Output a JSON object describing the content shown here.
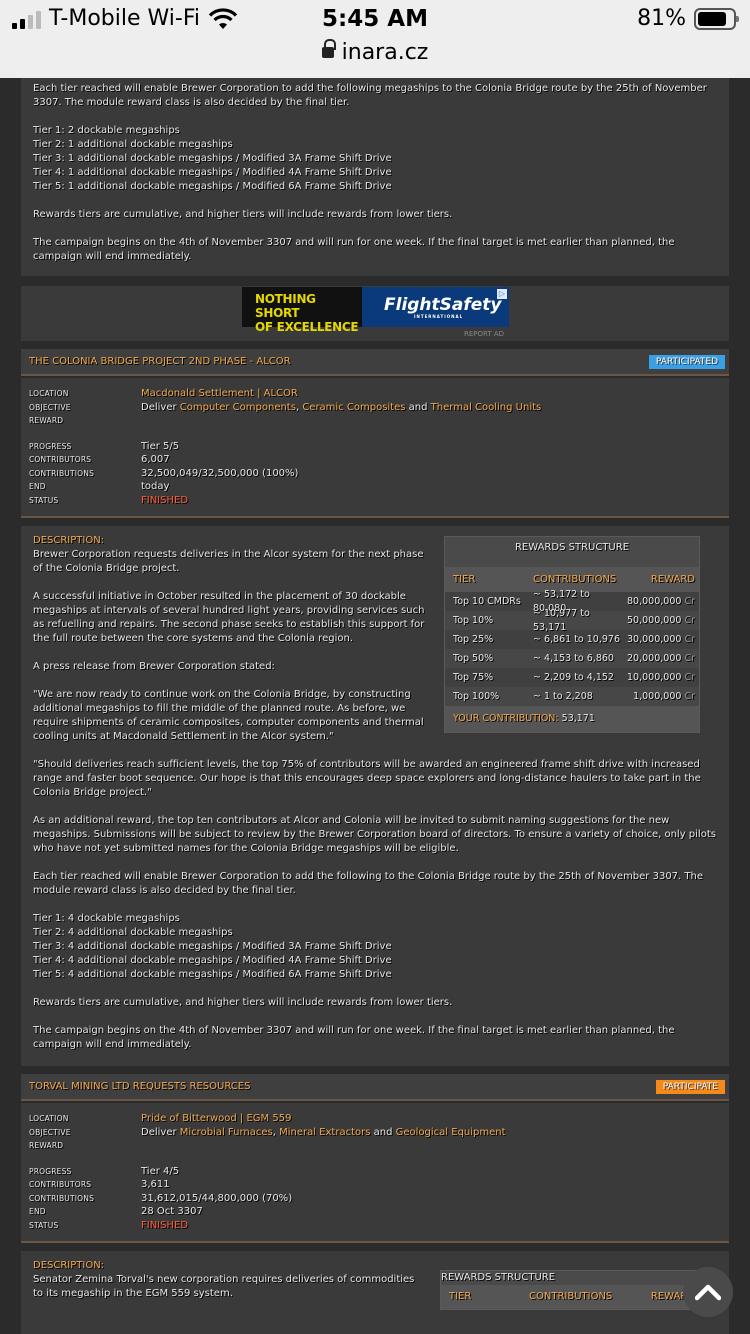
{
  "status_bar": {
    "carrier": "T-Mobile Wi-Fi",
    "time": "5:45 AM",
    "battery": "81%",
    "url": "inara.cz"
  },
  "top_section": {
    "paragraphs": [
      "Each tier reached will enable Brewer Corporation to add the following megaships to the Colonia Bridge route by the 25th of November 3307. The module reward class is also decided by the final tier.",
      "Tier 1: 2 dockable megaships\nTier 2: 1 additional dockable megaships\nTier 3: 1 additional dockable megaships / Modified 3A Frame Shift Drive\nTier 4: 1 additional dockable megaships / Modified 4A Frame Shift Drive\nTier 5: 1 additional dockable megaships / Modified 6A Frame Shift Drive",
      "Rewards tiers are cumulative, and higher tiers will include rewards from lower tiers.",
      "The campaign begins on the 4th of November 3307 and will run for one week. If the final target is met earlier than planned, the campaign will end immediately."
    ]
  },
  "ad": {
    "line1": "NOTHING SHORT",
    "line2": "OF EXCELLENCE",
    "brand": "FlightSafety",
    "brand_sub": "INTERNATIONAL",
    "report": "REPORT AD"
  },
  "labels": {
    "location": "LOCATION",
    "objective": "OBJECTIVE",
    "reward": "REWARD",
    "progress": "PROGRESS",
    "contributors": "CONTRIBUTORS",
    "contributions": "CONTRIBUTIONS",
    "end": "END",
    "status": "STATUS",
    "description": "DESCRIPTION:",
    "rewards_structure": "REWARDS STRUCTURE",
    "tier": "TIER",
    "contrib_col": "CONTRIBUTIONS",
    "reward_col": "REWARD",
    "your_contribution": "YOUR CONTRIBUTION:",
    "deliver": "Deliver",
    "and": "and",
    "cr": "Cr"
  },
  "cg1": {
    "title": "THE COLONIA BRIDGE PROJECT 2ND PHASE - ALCOR",
    "badge": "PARTICIPATED",
    "location": "Macdonald Settlement | ALCOR",
    "commodities": [
      "Computer Components",
      "Ceramic Composites",
      "Thermal Cooling Units"
    ],
    "progress": "Tier 5/5",
    "contributors": "6,007",
    "contributions": "32,500,049/32,500,000 (100%)",
    "end": "today",
    "status": "FINISHED",
    "description_intro": [
      "Brewer Corporation requests deliveries in the Alcor system for the next phase of the Colonia Bridge project.",
      "A successful initiative in October resulted in the placement of 30 dockable megaships at intervals of several hundred light years, providing services such as refuelling and repairs. The second phase seeks to establish this support for the full route between the core systems and the Colonia region.",
      "A press release from Brewer Corporation stated:",
      "\"We are now ready to continue work on the Colonia Bridge, by constructing additional megaships to fill the middle of the planned route. As before, we require shipments of ceramic composites, computer components and thermal cooling units at Macdonald Settlement in the Alcor system.\""
    ],
    "description_rest": [
      "\"Should deliveries reach sufficient levels, the top 75% of contributors will be awarded an engineered frame shift drive with increased range and faster boot sequence. Our hope is that this encourages deep space explorers and long-distance haulers to take part in the Colonia Bridge project.\"",
      "As an additional reward, the top ten contributors at Alcor and Colonia will be invited to submit naming suggestions for the new megaships. Submissions will be subject to review by the Brewer Corporation board of directors. To ensure a variety of choice, only pilots who have not yet submitted names for the Colonia Bridge megaships will be eligible.",
      "Each tier reached will enable Brewer Corporation to add the following to the Colonia Bridge route by the 25th of November 3307. The module reward class is also decided by the final tier.",
      "Tier 1: 4 dockable megaships\nTier 2: 4 additional dockable megaships\nTier 3: 4 additional dockable megaships / Modified 3A Frame Shift Drive\nTier 4: 4 additional dockable megaships / Modified 4A Frame Shift Drive\nTier 5: 4 additional dockable megaships / Modified 6A Frame Shift Drive",
      "Rewards tiers are cumulative, and higher tiers will include rewards from lower tiers.",
      "The campaign begins on the 4th of November 3307 and will run for one week. If the final target is met earlier than planned, the campaign will end immediately."
    ],
    "rewards": [
      {
        "tier": "Top 10 CMDRs",
        "contributions": "~ 53,172 to 80,080",
        "reward": "80,000,000"
      },
      {
        "tier": "Top 10%",
        "contributions": "~ 10,977 to 53,171",
        "reward": "50,000,000"
      },
      {
        "tier": "Top 25%",
        "contributions": "~ 6,861 to 10,976",
        "reward": "30,000,000"
      },
      {
        "tier": "Top 50%",
        "contributions": "~ 4,153 to 6,860",
        "reward": "20,000,000"
      },
      {
        "tier": "Top 75%",
        "contributions": "~ 2,209 to 4,152",
        "reward": "10,000,000"
      },
      {
        "tier": "Top 100%",
        "contributions": "~ 1 to 2,208",
        "reward": "1,000,000"
      }
    ],
    "your_contribution": "53,171"
  },
  "cg2": {
    "title": "TORVAL MINING LTD REQUESTS RESOURCES",
    "badge": "PARTICIPATE",
    "location": "Pride of Bitterwood | EGM 559",
    "commodities": [
      "Microbial Furnaces",
      "Mineral Extractors",
      "Geological Equipment"
    ],
    "progress": "Tier 4/5",
    "contributors": "3,611",
    "contributions": "31,612,015/44,800,000 (70%)",
    "end": "28 Oct 3307",
    "status": "FINISHED",
    "description_intro": "Senator Zemina Torval's new corporation requires deliveries of commodities to its megaship in the EGM 559 system."
  }
}
